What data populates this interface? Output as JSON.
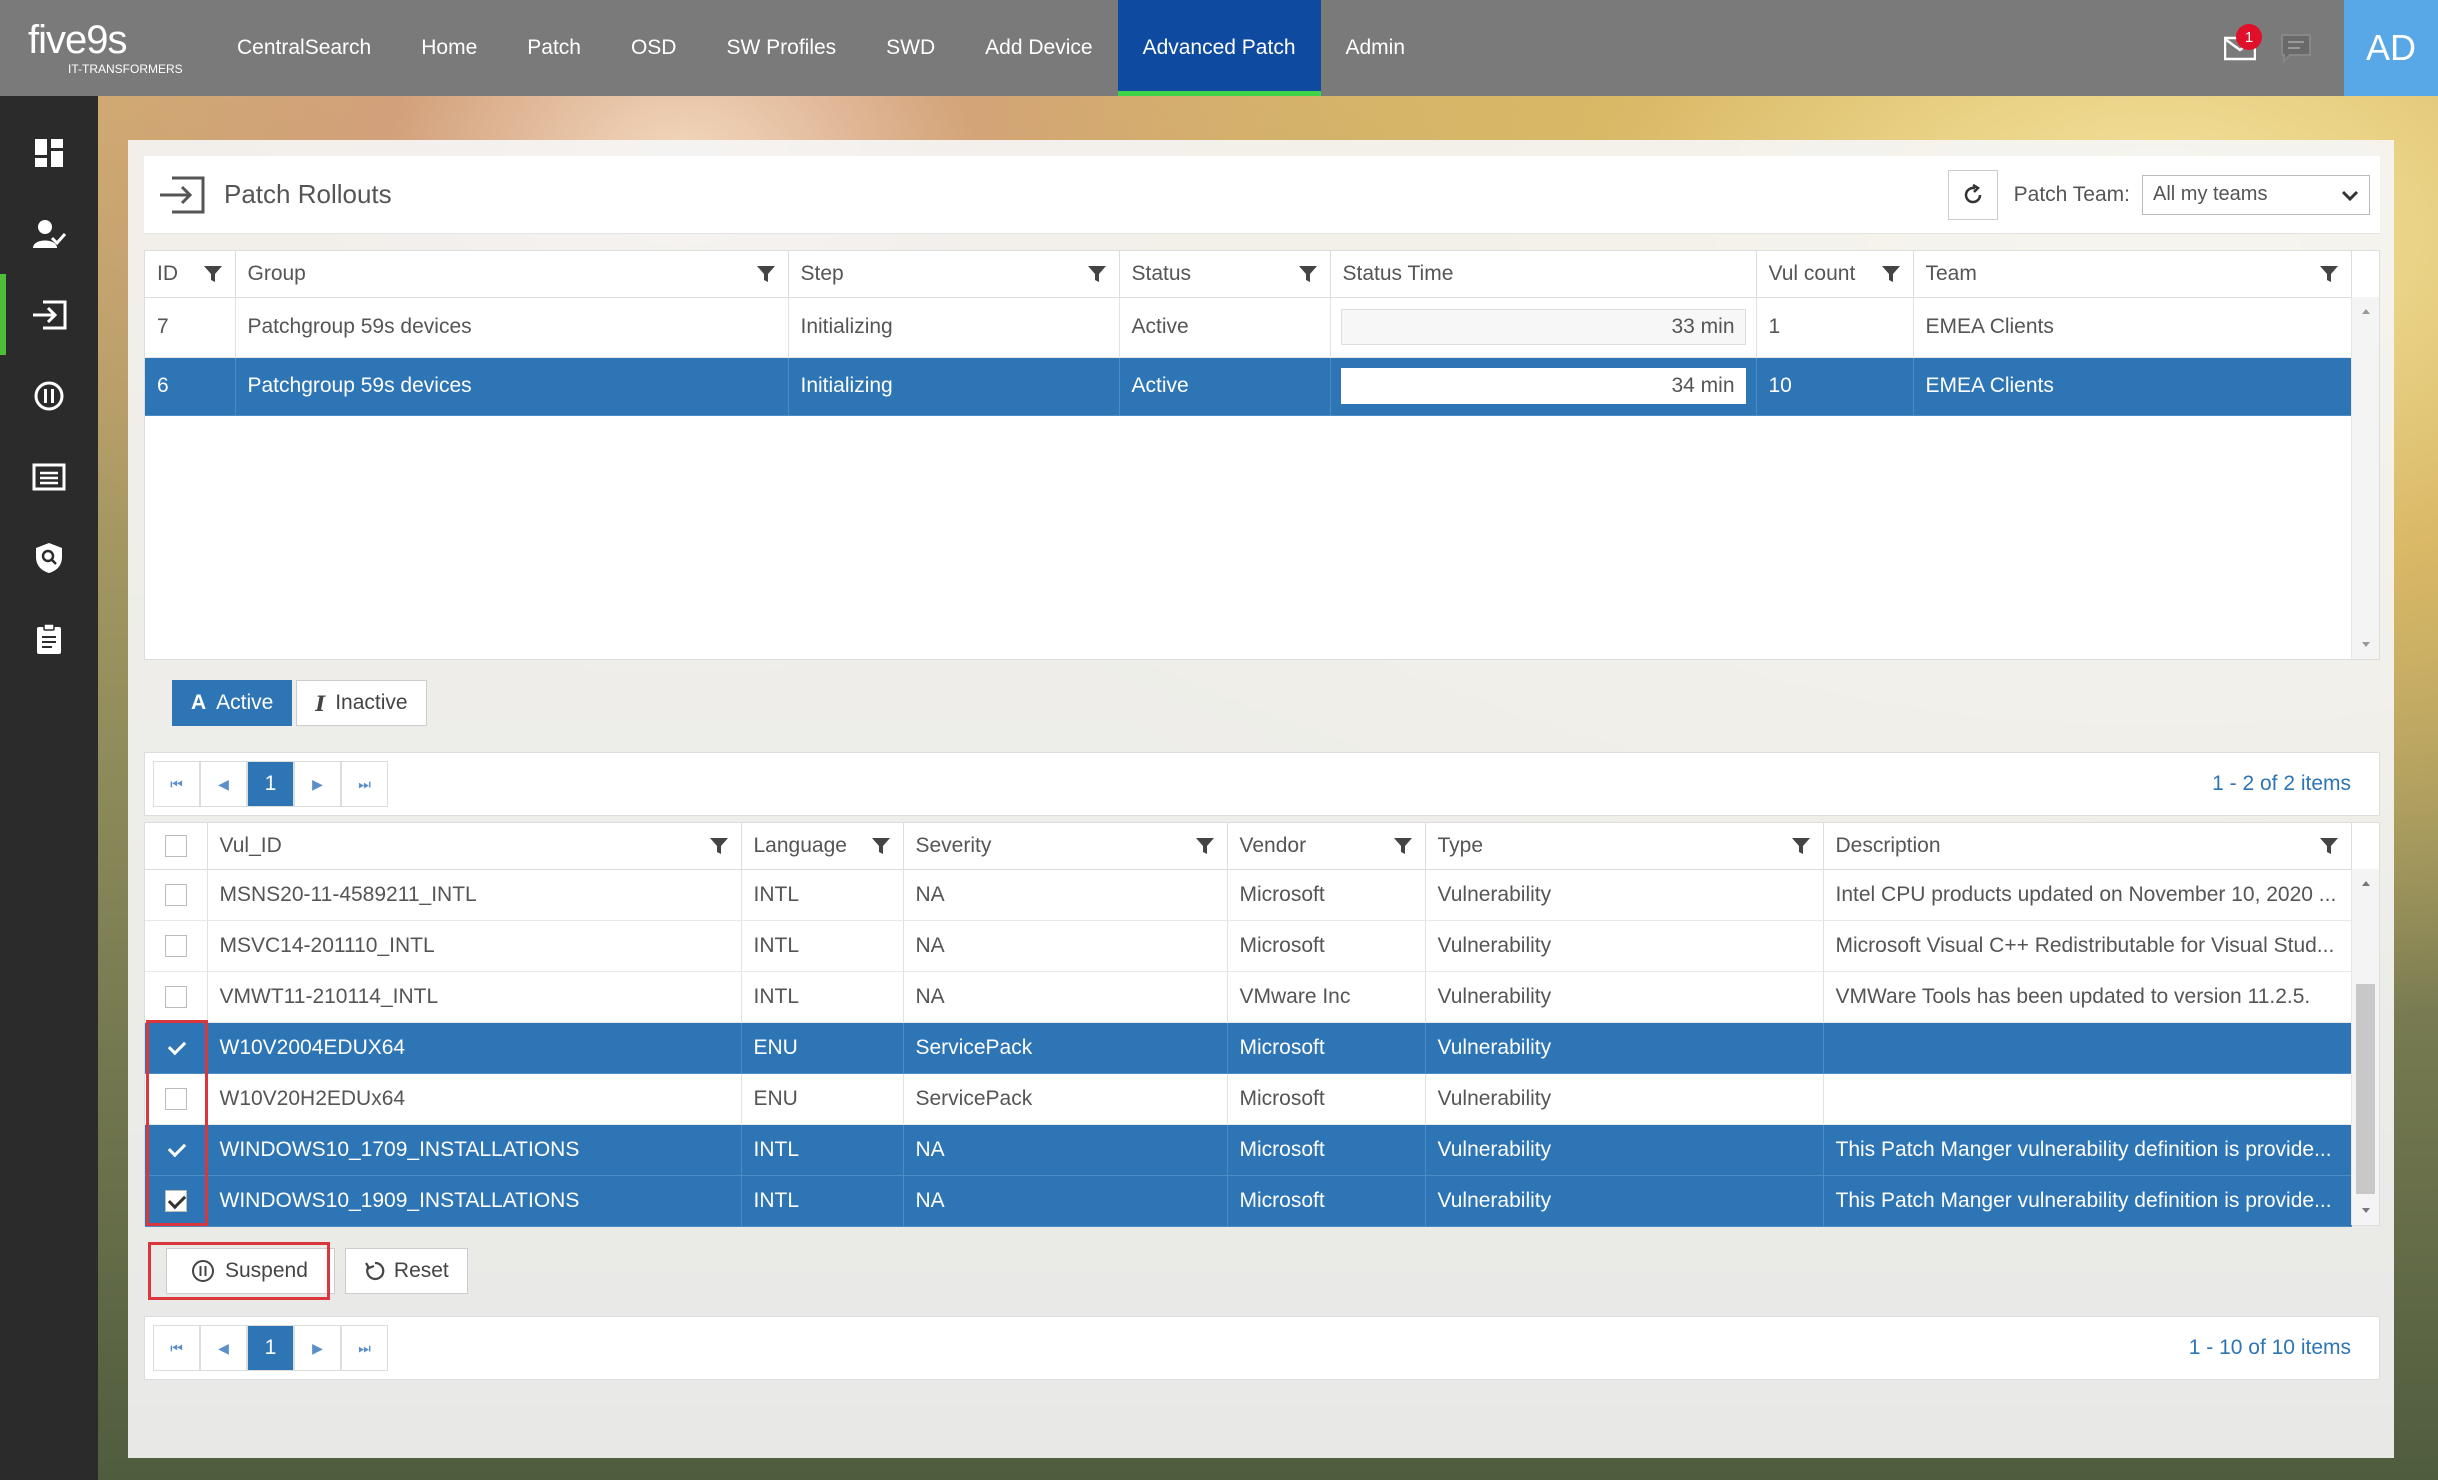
{
  "app": {
    "logo_text": "five9s",
    "logo_tagline": "IT-TRANSFORMERS",
    "nav": [
      {
        "label": "CentralSearch"
      },
      {
        "label": "Home"
      },
      {
        "label": "Patch"
      },
      {
        "label": "OSD"
      },
      {
        "label": "SW Profiles"
      },
      {
        "label": "SWD"
      },
      {
        "label": "Add Device"
      },
      {
        "label": "Advanced Patch",
        "active": true
      },
      {
        "label": "Admin"
      }
    ],
    "notification_count": "1",
    "avatar_initials": "AD",
    "colors": {
      "topbar": "#7a7a7a",
      "nav_active": "#0d4aa0",
      "accent_green": "#3fd34a",
      "selection": "#2e75b6",
      "avatar": "#58a8e8",
      "highlight_red": "#d9363e"
    }
  },
  "sidebar": {
    "items": [
      {
        "icon": "dashboard-icon"
      },
      {
        "icon": "user-check-icon"
      },
      {
        "icon": "rollout-icon",
        "active": true
      },
      {
        "icon": "pause-circle-icon"
      },
      {
        "icon": "list-icon"
      },
      {
        "icon": "shield-search-icon"
      },
      {
        "icon": "clipboard-icon"
      }
    ]
  },
  "panel": {
    "title": "Patch Rollouts",
    "patch_team_label": "Patch Team:",
    "patch_team_value": "All my teams"
  },
  "rollouts": {
    "columns": [
      "ID",
      "Group",
      "Step",
      "Status",
      "Status Time",
      "Vul count",
      "Team"
    ],
    "rows": [
      {
        "id": "7",
        "group": "Patchgroup 59s devices",
        "step": "Initializing",
        "status": "Active",
        "status_time": "33 min",
        "vul_count": "1",
        "team": "EMEA Clients",
        "selected": false
      },
      {
        "id": "6",
        "group": "Patchgroup 59s devices",
        "step": "Initializing",
        "status": "Active",
        "status_time": "34 min",
        "vul_count": "10",
        "team": "EMEA Clients",
        "selected": true
      }
    ],
    "toggle_active": "Active",
    "toggle_inactive": "Inactive",
    "toggle_active_icon": "A",
    "toggle_inactive_icon": "I",
    "pager_page": "1",
    "pager_info": "1 - 2 of 2 items"
  },
  "vulns": {
    "columns": [
      "Vul_ID",
      "Language",
      "Severity",
      "Vendor",
      "Type",
      "Description"
    ],
    "rows": [
      {
        "vul_id": "MSNS20-11-4589211_INTL",
        "language": "INTL",
        "severity": "NA",
        "vendor": "Microsoft",
        "type": "Vulnerability",
        "description": "Intel CPU products updated on November 10, 2020 ...",
        "selected": false,
        "checked": false
      },
      {
        "vul_id": "MSVC14-201110_INTL",
        "language": "INTL",
        "severity": "NA",
        "vendor": "Microsoft",
        "type": "Vulnerability",
        "description": "Microsoft Visual C++ Redistributable for Visual Stud...",
        "selected": false,
        "checked": false
      },
      {
        "vul_id": "VMWT11-210114_INTL",
        "language": "INTL",
        "severity": "NA",
        "vendor": "VMware Inc",
        "type": "Vulnerability",
        "description": "VMWare Tools has been updated to version 11.2.5.",
        "selected": false,
        "checked": false
      },
      {
        "vul_id": "W10V2004EDUX64",
        "language": "ENU",
        "severity": "ServicePack",
        "vendor": "Microsoft",
        "type": "Vulnerability",
        "description": "",
        "selected": true,
        "checked": true
      },
      {
        "vul_id": "W10V20H2EDUx64",
        "language": "ENU",
        "severity": "ServicePack",
        "vendor": "Microsoft",
        "type": "Vulnerability",
        "description": "",
        "selected": false,
        "checked": false
      },
      {
        "vul_id": "WINDOWS10_1709_INSTALLATIONS",
        "language": "INTL",
        "severity": "NA",
        "vendor": "Microsoft",
        "type": "Vulnerability",
        "description": "This Patch Manger vulnerability definition is provide...",
        "selected": true,
        "checked": true
      },
      {
        "vul_id": "WINDOWS10_1909_INSTALLATIONS",
        "language": "INTL",
        "severity": "NA",
        "vendor": "Microsoft",
        "type": "Vulnerability",
        "description": "This Patch Manger vulnerability definition is provide...",
        "selected": true,
        "checked": true,
        "boxed": true
      }
    ],
    "suspend_label": "Suspend",
    "reset_label": "Reset",
    "pager_page": "1",
    "pager_info": "1 - 10 of 10 items"
  }
}
